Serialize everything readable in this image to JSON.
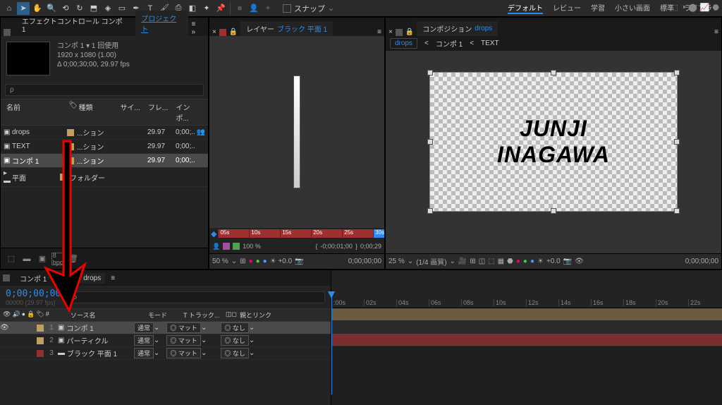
{
  "toolbar": {
    "snap_label": "スナップ"
  },
  "workspaces": [
    "デフォルト",
    "レビュー",
    "学習",
    "小さい画面",
    "標準",
    "ライブラリ"
  ],
  "project_panel": {
    "tab1": "エフェクトコントロール コンポ 1",
    "tab2": "プロジェクト",
    "meta_title": "コンポ 1 ▾ 1 回使用",
    "meta_dim": "1920 x 1080 (1.00)",
    "meta_dur": "Δ 0;00;30;00, 29.97 fps",
    "search_placeholder": "ρ",
    "col_name": "名前",
    "col_type": "種類",
    "col_size": "サイ...",
    "col_fps": "フレ...",
    "col_in": "インポ...",
    "items": [
      {
        "icon": "■",
        "name": "drops",
        "type": "...ション",
        "size": "",
        "fps": "29.97",
        "in": "0;00;.."
      },
      {
        "icon": "■",
        "name": "TEXT",
        "type": "...ション",
        "size": "",
        "fps": "29.97",
        "in": "0;00;.."
      },
      {
        "icon": "■",
        "name": "コンポ 1",
        "type": "...ション",
        "size": "",
        "fps": "29.97",
        "in": "0;00;.."
      },
      {
        "icon": "▸",
        "name": "平面",
        "type": "フォルダー",
        "size": "",
        "fps": "",
        "in": ""
      }
    ]
  },
  "layer_panel": {
    "tab": "レイヤー",
    "tab_name": "ブラック 平面 1",
    "marks": [
      "05s",
      "10s",
      "15s",
      "20s",
      "25s",
      "30s"
    ],
    "ctrl_pct": "100 %",
    "ctrl_t1": "-0;00;01;00",
    "ctrl_t2": "0;00;29",
    "zoom": "50 %",
    "time": "0;00;00;00"
  },
  "comp_panel": {
    "tab": "コンポジション",
    "tab_name": "drops",
    "bc1": "drops",
    "bc2": "コンポ 1",
    "bc3": "TEXT",
    "text1": "JUNJI",
    "text2": "INAGAWA",
    "zoom": "25 %",
    "quality": "(1/4 画質)",
    "exp": "+0.0",
    "time": "0;00;00;00"
  },
  "timeline": {
    "tab1": "コンポ 1",
    "tab2": "drops",
    "timecode": "0;00;00;00",
    "sub": "00000 (29.97 fps)",
    "col_src": "ソース名",
    "col_mode": "モード",
    "col_track": "T トラック...",
    "col_parent": "親とリンク",
    "layers": [
      {
        "n": "1",
        "name": "コンポ 1",
        "mode": "通常",
        "track": "マット",
        "parent": "なし",
        "sel": true,
        "sw": "#c0a060"
      },
      {
        "n": "2",
        "name": "パーティクル",
        "mode": "通常",
        "track": "マット",
        "parent": "なし",
        "sel": false,
        "sw": "#c0a060"
      },
      {
        "n": "3",
        "name": "ブラック 平面 1",
        "mode": "通常",
        "track": "マット",
        "parent": "なし",
        "sel": false,
        "sw": "#903030"
      }
    ],
    "ruler": [
      ":00s",
      "02s",
      "04s",
      "06s",
      "08s",
      "10s",
      "12s",
      "14s",
      "16s",
      "18s",
      "20s",
      "22s"
    ]
  }
}
